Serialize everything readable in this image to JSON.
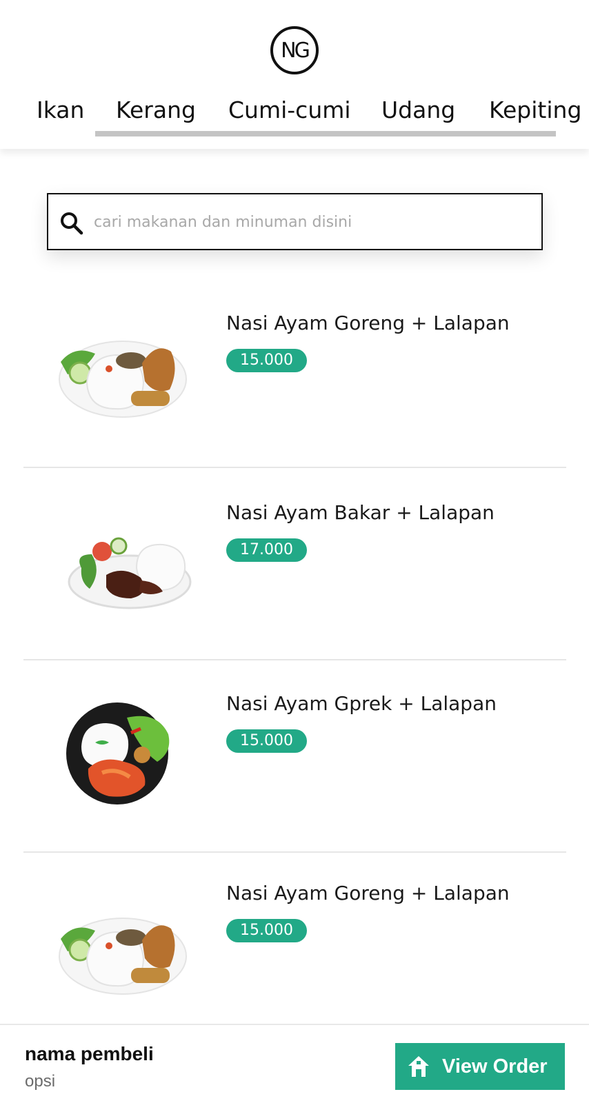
{
  "header": {
    "logo_text": "NG",
    "tabs": [
      {
        "label": "Ikan"
      },
      {
        "label": "Kerang"
      },
      {
        "label": "Cumi-cumi"
      },
      {
        "label": "Udang"
      },
      {
        "label": "Kepiting"
      }
    ],
    "active_tab_index": 1
  },
  "search": {
    "placeholder": "cari makanan dan minuman disini",
    "value": ""
  },
  "menu_items": [
    {
      "name": "Nasi Ayam Goreng + Lalapan",
      "price": "15.000",
      "image": "fried-chicken-rice-plate"
    },
    {
      "name": "Nasi Ayam Bakar + Lalapan",
      "price": "17.000",
      "image": "grilled-chicken-rice-plate"
    },
    {
      "name": "Nasi Ayam Gprek + Lalapan",
      "price": "15.000",
      "image": "geprek-chicken-rice-plate"
    },
    {
      "name": "Nasi Ayam Goreng + Lalapan",
      "price": "15.000",
      "image": "fried-chicken-rice-plate"
    }
  ],
  "bottom_bar": {
    "buyer_name": "nama pembeli",
    "buyer_option": "opsi",
    "view_order_label": "View Order",
    "icon": "home-icon"
  },
  "colors": {
    "accent": "#22a987",
    "tab_indicator": "#c4c4c4",
    "divider": "#e6e6e6"
  }
}
